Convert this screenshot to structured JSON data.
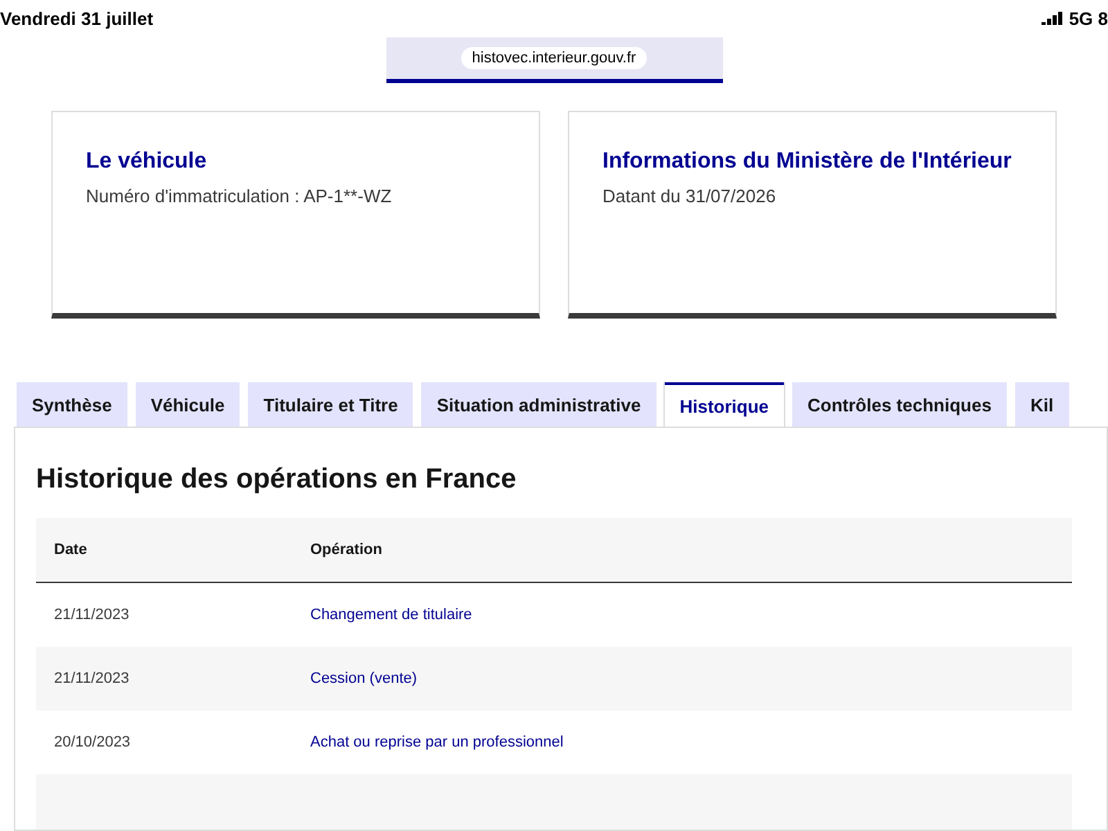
{
  "status_bar": {
    "date": "Vendredi 31 juillet",
    "network": "5G 8"
  },
  "address_bar": {
    "url": "histovec.interieur.gouv.fr"
  },
  "cards": [
    {
      "title": "Le véhicule",
      "text": "Numéro d'immatriculation : AP-1**-WZ"
    },
    {
      "title": "Informations du Ministère de l'Intérieur",
      "text": "Datant du 31/07/2026"
    }
  ],
  "tabs": [
    {
      "label": "Synthèse",
      "selected": false
    },
    {
      "label": "Véhicule",
      "selected": false
    },
    {
      "label": "Titulaire et Titre",
      "selected": false
    },
    {
      "label": "Situation administrative",
      "selected": false
    },
    {
      "label": "Historique",
      "selected": true
    },
    {
      "label": "Contrôles techniques",
      "selected": false
    },
    {
      "label": "Kil",
      "selected": false
    }
  ],
  "panel": {
    "title": "Historique des opérations en France",
    "table": {
      "columns": [
        "Date",
        "Opération"
      ],
      "rows": [
        [
          "21/11/2023",
          "Changement de titulaire"
        ],
        [
          "21/11/2023",
          "Cession (vente)"
        ],
        [
          "20/10/2023",
          "Achat ou reprise par un professionnel"
        ]
      ]
    }
  }
}
